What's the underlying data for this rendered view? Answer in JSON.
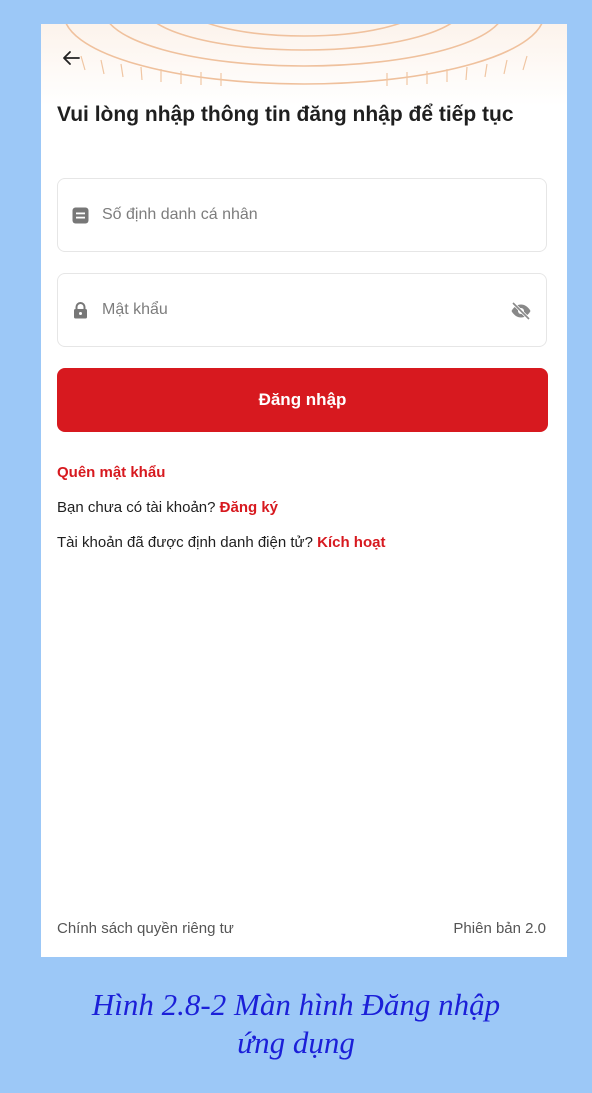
{
  "header": {
    "title": "Vui lòng nhập thông tin đăng nhập để tiếp tục"
  },
  "form": {
    "id_field": {
      "placeholder": "Số định danh cá nhân",
      "value": "",
      "icon": "id-card-icon"
    },
    "password_field": {
      "placeholder": "Mật khẩu",
      "value": "",
      "icon": "lock-icon",
      "toggle_icon": "eye-slash-icon"
    },
    "login_button_label": "Đăng nhập"
  },
  "links": {
    "forgot_password": "Quên mật khẩu",
    "register_prompt": "Bạn chưa có tài khoản?",
    "register_link": "Đăng ký",
    "activate_prompt": "Tài khoản đã được định danh điện tử?",
    "activate_link": "Kích hoạt"
  },
  "footer": {
    "privacy": "Chính sách quyền riêng tư",
    "version": "Phiên bản 2.0"
  },
  "caption": {
    "line1": "Hình 2.8-2 Màn hình Đăng nhập",
    "line2": "ứng dụng"
  },
  "colors": {
    "accent": "#d7191f",
    "page_background": "#9cc8f7",
    "caption_text": "#1b1fd8"
  }
}
